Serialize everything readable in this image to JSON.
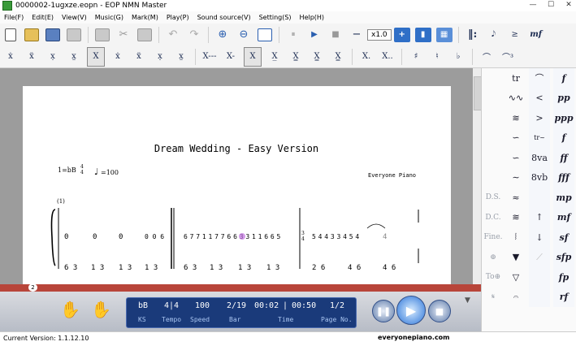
{
  "window": {
    "title": "0000002-1ugxze.eopn - EOP NMN Master"
  },
  "menu": [
    "File(F)",
    "Edit(E)",
    "View(V)",
    "Music(G)",
    "Mark(M)",
    "Play(P)",
    "Sound source(V)",
    "Setting(S)",
    "Help(H)"
  ],
  "toolbar": {
    "speed": "x1.0",
    "tb1_tail": [
      "𝅘𝅥𝅮",
      "≥",
      "mf"
    ]
  },
  "toolbar2": [
    "ẋ",
    "ẍ",
    "x̣",
    "x̤",
    "X",
    "ẋ",
    "ẍ",
    "x̣",
    "x̤",
    "X---",
    "X-",
    "X",
    "X̲",
    "X̳",
    "X̳",
    "X̳",
    "X.",
    "X..",
    "♯",
    "♮",
    "♭",
    "⌒",
    "⌒³"
  ],
  "score": {
    "title": "Dream Wedding - Easy Version",
    "key": "1=bB",
    "time_top": "4",
    "time_bottom": "4",
    "tempo": "=100",
    "publisher": "Everyone Piano",
    "measure_label": "(1)",
    "upper": [
      "0",
      "0",
      "0",
      "0 0 6",
      "6 7 7 1 1 7 7 6 6 3 3 1 1 6 6 5",
      "5 4 4 3 3 4 5 4",
      "4"
    ],
    "lower": [
      "6 3",
      "1 3",
      "1 3",
      "1 3",
      "6 3",
      "1 3",
      "1 3",
      "1 3",
      "2 6",
      "4 6",
      "4 6"
    ],
    "time2_top": "3",
    "time2_bottom": "4"
  },
  "palette": {
    "col0": [
      "",
      "",
      "",
      "",
      "",
      "",
      "D.S.",
      "D.C.",
      "Fine.",
      "⊕",
      "To⊕",
      "𝄋"
    ],
    "col1": [
      "tr",
      "∿∿",
      "≋",
      "∽",
      "∽",
      "∼",
      "≈",
      "≋",
      "𝆃",
      "▼",
      "▽",
      "𝄐"
    ],
    "col2": [
      "⌒",
      "<",
      ">",
      "tr~",
      "8va",
      "8vb",
      "",
      "↑",
      "↓",
      "",
      "",
      ""
    ],
    "col3": [
      "f",
      "pp",
      "ppp",
      "f",
      "ff",
      "fff",
      "mp",
      "mf",
      "sf",
      "sfp",
      "fp",
      "rf"
    ]
  },
  "ruler": {
    "marker": "2"
  },
  "lcd": {
    "values": [
      "bB",
      "4|4",
      "100",
      "2/19",
      "00:02",
      "|",
      "00:50",
      "1/2"
    ],
    "labels": [
      "KS",
      "Tempo",
      "Speed",
      "Bar",
      "Time",
      "Page No."
    ]
  },
  "statusbar": {
    "version": "Current Version: 1.1.12.10",
    "site": "everyonepiano.com"
  }
}
